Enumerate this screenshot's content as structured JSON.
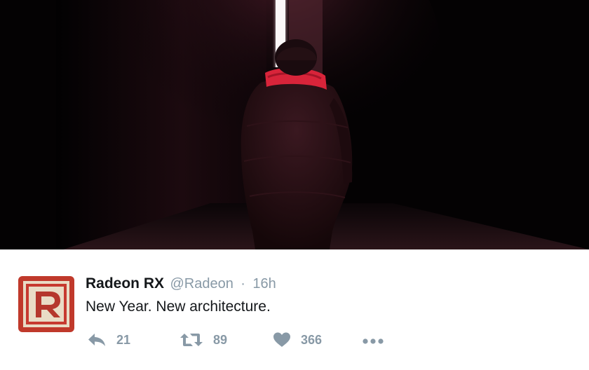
{
  "tweet": {
    "author": {
      "display_name": "Radeon RX",
      "handle": "@Radeon",
      "avatar_letter": "R"
    },
    "separator": "·",
    "timestamp": "16h",
    "text": "New Year. New architecture.",
    "actions": {
      "reply": {
        "icon": "reply-icon",
        "count": "21"
      },
      "retweet": {
        "icon": "retweet-icon",
        "count": "89"
      },
      "like": {
        "icon": "heart-icon",
        "count": "366"
      },
      "more": {
        "icon": "more-dots-icon"
      }
    },
    "media": {
      "description_icon": "photo-person-in-dark-corridor"
    }
  },
  "colors": {
    "text_primary": "#14171a",
    "text_secondary": "#8899a6",
    "avatar_red": "#c0392b",
    "avatar_cream": "#e9dcc6",
    "scarf_red": "#d8243a",
    "light_beam": "#f1e7ea"
  }
}
